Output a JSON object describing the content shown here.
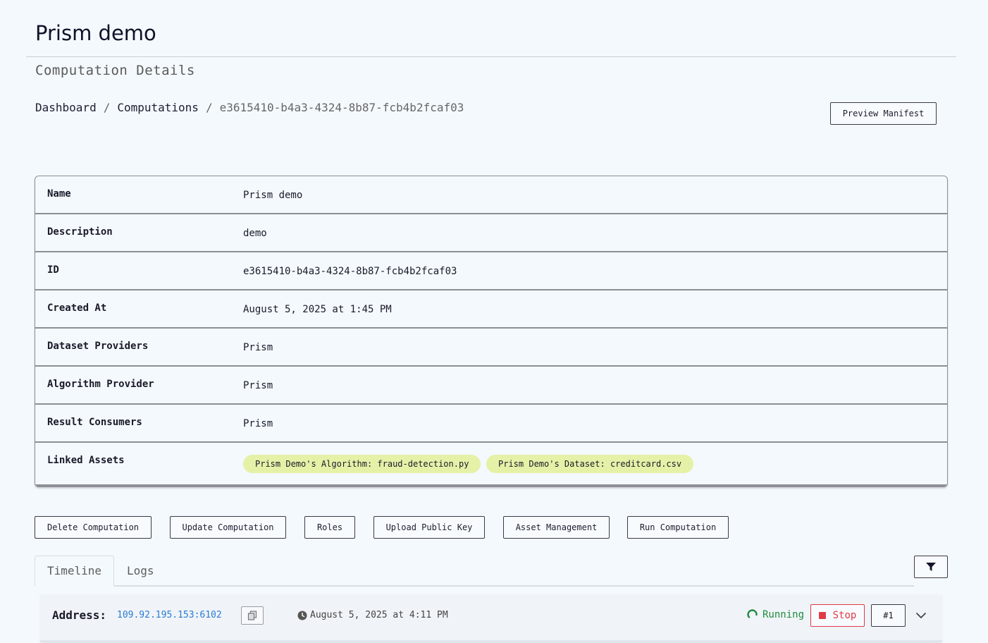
{
  "app": {
    "title": "Prism demo"
  },
  "page": {
    "subtitle": "Computation Details"
  },
  "breadcrumb": {
    "items": [
      "Dashboard",
      "Computations"
    ],
    "separator": "/",
    "current": "e3615410-b4a3-4324-8b87-fcb4b2fcaf03"
  },
  "header": {
    "preview_manifest_label": "Preview Manifest"
  },
  "details": {
    "rows": [
      {
        "label": "Name",
        "value": "Prism demo"
      },
      {
        "label": "Description",
        "value": "demo"
      },
      {
        "label": "ID",
        "value": "e3615410-b4a3-4324-8b87-fcb4b2fcaf03"
      },
      {
        "label": "Created At",
        "value": "August 5, 2025 at 1:45 PM"
      },
      {
        "label": "Dataset Providers",
        "value": "Prism"
      },
      {
        "label": "Algorithm Provider",
        "value": "Prism"
      },
      {
        "label": "Result Consumers",
        "value": "Prism"
      },
      {
        "label": "Linked Assets",
        "value": ""
      }
    ],
    "linked_assets": [
      "Prism Demo's Algorithm: fraud-detection.py",
      "Prism Demo's Dataset: creditcard.csv"
    ]
  },
  "actions": [
    "Delete Computation",
    "Update Computation",
    "Roles",
    "Upload Public Key",
    "Asset Management",
    "Run Computation"
  ],
  "tabs": {
    "timeline": "Timeline",
    "logs": "Logs",
    "active": "Timeline"
  },
  "timeline": {
    "address_label": "Address:",
    "address": "109.92.195.153:6102",
    "time": "August 5, 2025 at 4:11 PM",
    "status": "Running",
    "stop_label": "Stop",
    "run_number": "#1"
  },
  "colors": {
    "accent_link": "#2a7bd4",
    "running": "#1e8a3d",
    "stop": "#e03a47",
    "pill": "#e5f1a7",
    "background": "#f4f9fe"
  },
  "icons": [
    "copy-icon",
    "clock-icon",
    "spinner-icon",
    "stop-icon",
    "filter-icon",
    "chevron-down-icon"
  ]
}
